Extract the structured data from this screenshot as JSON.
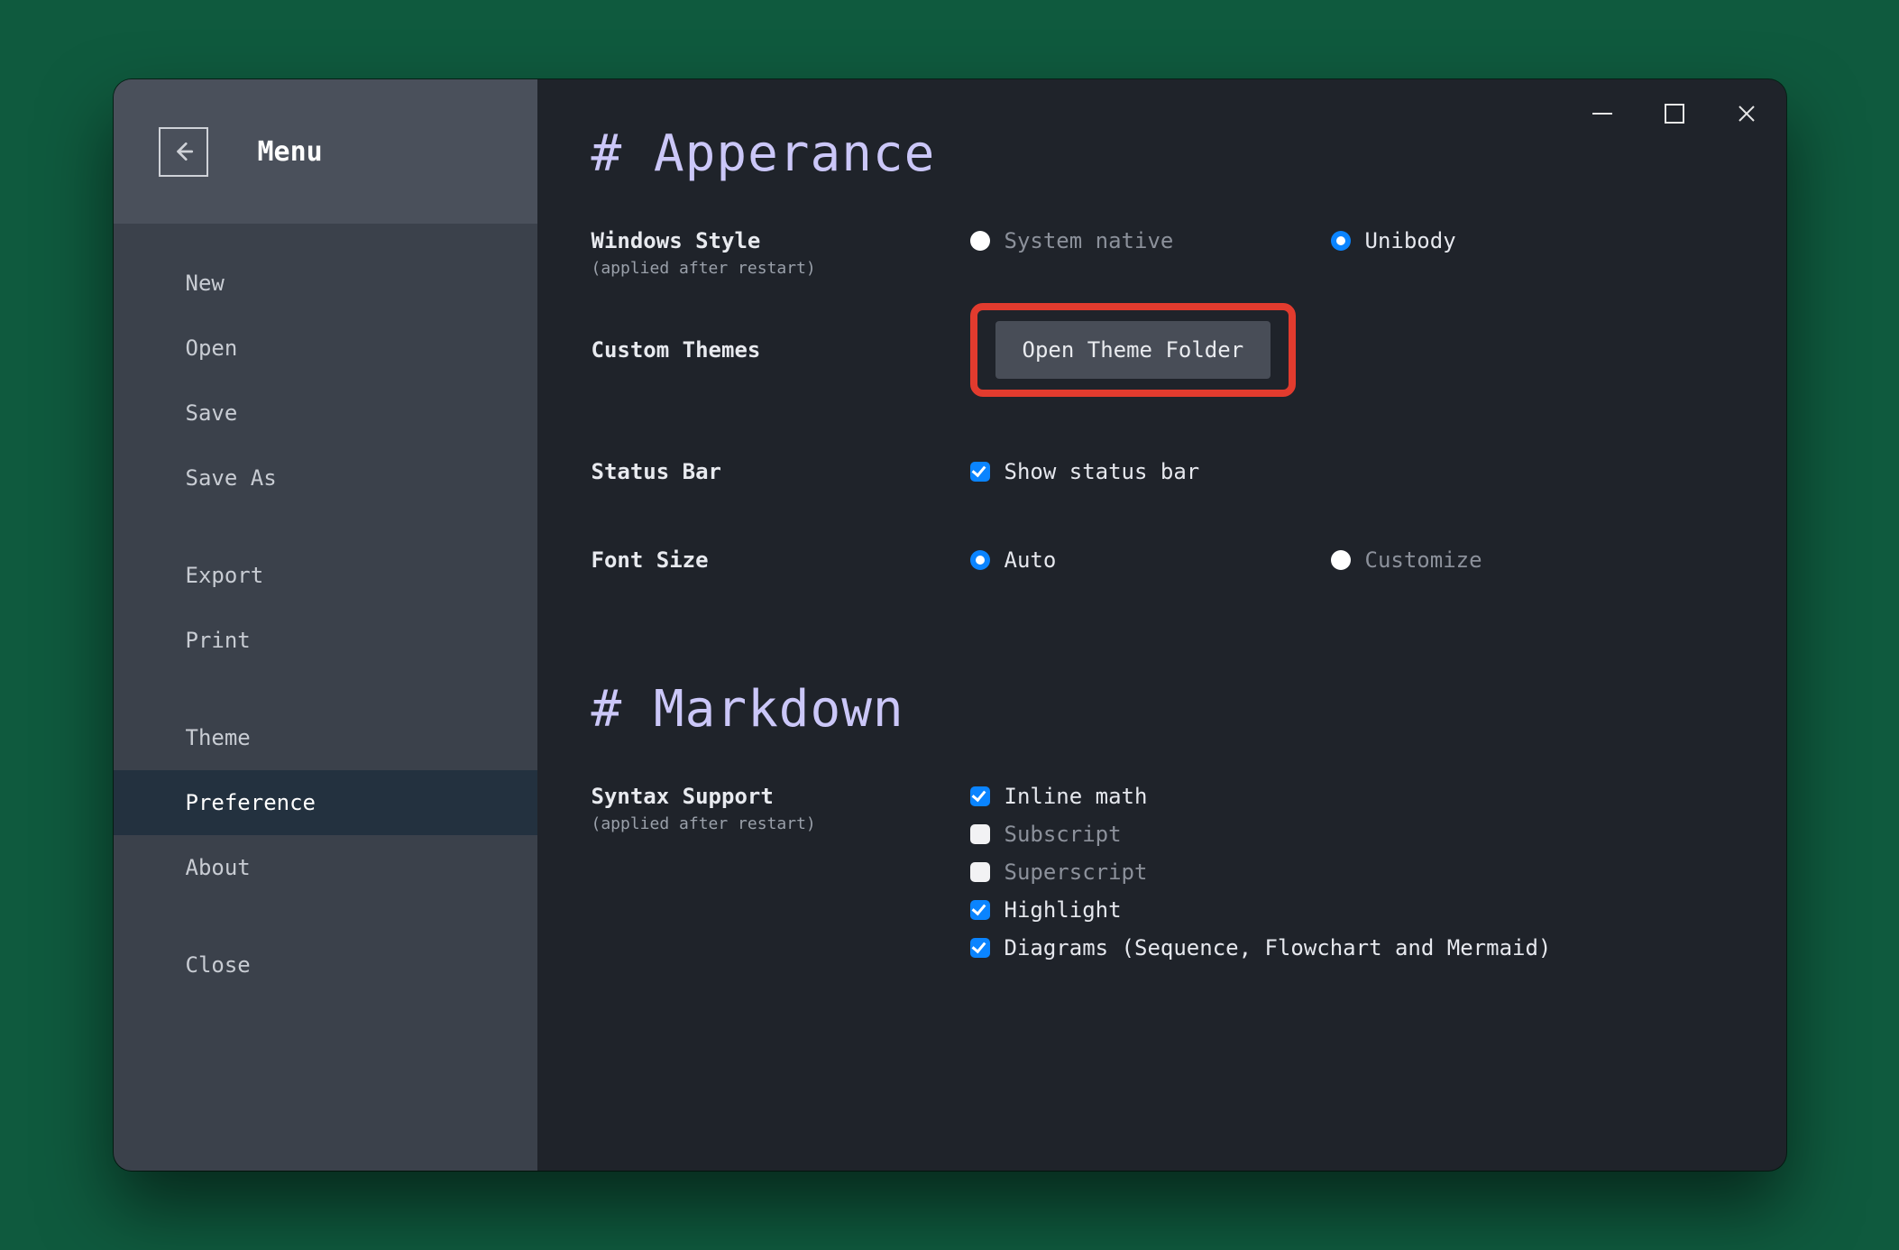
{
  "sidebar": {
    "title": "Menu",
    "groups": [
      [
        "New",
        "Open",
        "Save",
        "Save As"
      ],
      [
        "Export",
        "Print"
      ],
      [
        "Theme",
        "Preference",
        "About"
      ],
      [
        "Close"
      ]
    ],
    "active": "Preference"
  },
  "appearance": {
    "heading": "# Apperance",
    "windows_style": {
      "label": "Windows Style",
      "sub": "(applied after restart)",
      "options": [
        "System native",
        "Unibody"
      ],
      "selected": "Unibody"
    },
    "custom_themes": {
      "label": "Custom Themes",
      "button": "Open Theme Folder"
    },
    "status_bar": {
      "label": "Status Bar",
      "option": "Show status bar",
      "checked": true
    },
    "font_size": {
      "label": "Font Size",
      "options": [
        "Auto",
        "Customize"
      ],
      "selected": "Auto"
    }
  },
  "markdown": {
    "heading": "# Markdown",
    "syntax": {
      "label": "Syntax Support",
      "sub": "(applied after restart)",
      "options": [
        {
          "label": "Inline math",
          "checked": true
        },
        {
          "label": "Subscript",
          "checked": false
        },
        {
          "label": "Superscript",
          "checked": false
        },
        {
          "label": "Highlight",
          "checked": true
        },
        {
          "label": "Diagrams (Sequence, Flowchart and Mermaid)",
          "checked": true
        }
      ]
    }
  },
  "colors": {
    "accent": "#0a84ff",
    "heading": "#cbc7f8",
    "highlight_border": "#e23b2e"
  }
}
